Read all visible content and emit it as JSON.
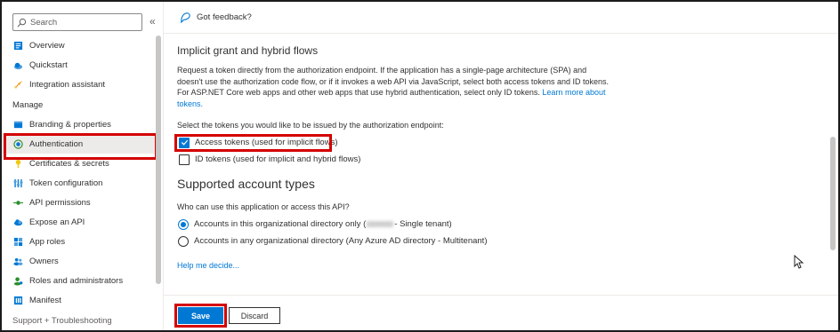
{
  "search": {
    "placeholder": "Search"
  },
  "sidebar": {
    "collapse_glyph": "«",
    "items_top": [
      {
        "label": "Overview",
        "icon": "overview-icon"
      },
      {
        "label": "Quickstart",
        "icon": "quickstart-icon"
      },
      {
        "label": "Integration assistant",
        "icon": "rocket-icon"
      }
    ],
    "manage_heading": "Manage",
    "items_manage": [
      {
        "label": "Branding & properties",
        "icon": "branding-icon"
      },
      {
        "label": "Authentication",
        "icon": "authentication-icon",
        "active": true
      },
      {
        "label": "Certificates & secrets",
        "icon": "key-icon"
      },
      {
        "label": "Token configuration",
        "icon": "token-config-icon"
      },
      {
        "label": "API permissions",
        "icon": "api-permissions-icon"
      },
      {
        "label": "Expose an API",
        "icon": "cloud-icon"
      },
      {
        "label": "App roles",
        "icon": "app-roles-icon"
      },
      {
        "label": "Owners",
        "icon": "owners-icon"
      },
      {
        "label": "Roles and administrators",
        "icon": "roles-icon"
      },
      {
        "label": "Manifest",
        "icon": "manifest-icon"
      }
    ],
    "cutoff_item": "Support + Troubleshooting"
  },
  "topbar": {
    "feedback_label": "Got feedback?"
  },
  "implicit": {
    "heading": "Implicit grant and hybrid flows",
    "description": "Request a token directly from the authorization endpoint. If the application has a single-page architecture (SPA) and doesn't use the authorization code flow, or if it invokes a web API via JavaScript, select both access tokens and ID tokens. For ASP.NET Core web apps and other web apps that use hybrid authentication, select only ID tokens.",
    "learn_more": "Learn more about tokens.",
    "prompt": "Select the tokens you would like to be issued by the authorization endpoint:",
    "access_tokens": {
      "label": "Access tokens (used for implicit flows)",
      "checked": true
    },
    "id_tokens": {
      "label": "ID tokens (used for implicit and hybrid flows)",
      "checked": false
    }
  },
  "account_types": {
    "heading": "Supported account types",
    "prompt": "Who can use this application or access this API?",
    "option_single_prefix": "Accounts in this organizational directory only (",
    "option_single_suffix": " - Single tenant)",
    "option_multi": "Accounts in any organizational directory (Any Azure AD directory - Multitenant)",
    "selected": "single"
  },
  "help_link": "Help me decide...",
  "footer": {
    "save_label": "Save",
    "discard_label": "Discard"
  },
  "colors": {
    "accent": "#0078d4",
    "highlight": "#d40000"
  }
}
